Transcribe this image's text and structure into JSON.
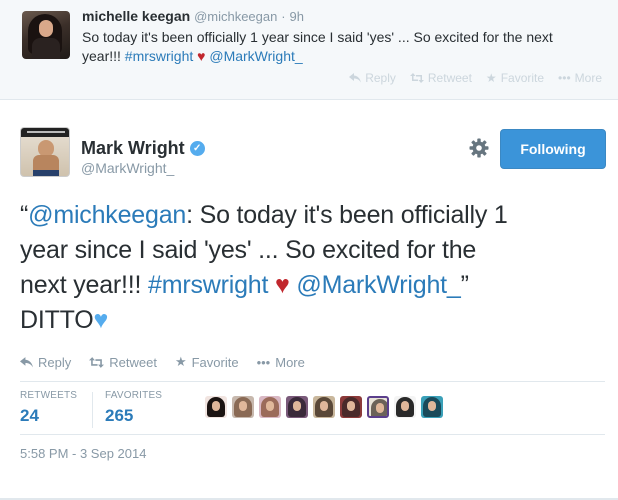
{
  "top_tweet": {
    "name": "michelle keegan",
    "handle": "@michkeegan",
    "separator": "·",
    "time": "9h",
    "text_line1": "So today it's been officially 1 year since I said 'yes' ... So excited for the next",
    "text_line2_prefix": "year!!! ",
    "hashtag": "#mrswright",
    "heart": "♥",
    "mention": "@MarkWright_",
    "actions": {
      "reply": "Reply",
      "retweet": "Retweet",
      "favorite": "Favorite",
      "more": "More"
    },
    "icons": [
      "reply-icon",
      "retweet-icon",
      "star-icon",
      "more-dots-icon"
    ]
  },
  "main_tweet": {
    "name": "Mark Wright",
    "verified_glyph": "✓",
    "handle": "@MarkWright_",
    "follow_label": "Following",
    "quote_open": "“",
    "quote_mention": "@michkeegan",
    "quote_line1_rest": ": So today it's been officially 1",
    "quote_line2": "year since I said 'yes' ... So excited for the",
    "quote_line3_prefix": "next year!!! ",
    "quote_hashtag": "#mrswright",
    "quote_heart": "♥",
    "quote_mention2": "@MarkWright_",
    "quote_close": "”",
    "reply_text": "DITTO",
    "blue_heart": "♥",
    "actions": {
      "reply": "Reply",
      "retweet": "Retweet",
      "favorite": "Favorite",
      "more": "More"
    },
    "stats": {
      "retweets_label": "RETWEETS",
      "retweets_value": "24",
      "favorites_label": "FAVORITES",
      "favorites_value": "265"
    },
    "timestamp": "5:58 PM - 3 Sep 2014"
  },
  "colors": {
    "link": "#2b7bb9",
    "follow_button": "#3b94d9",
    "heart_red": "#c1272d",
    "heart_blue": "#55acee",
    "muted": "#8899a6"
  }
}
